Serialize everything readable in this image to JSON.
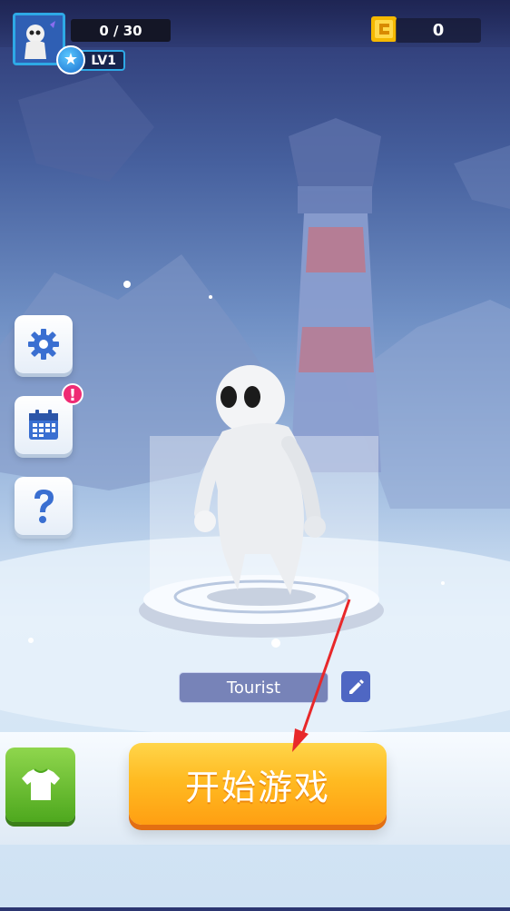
{
  "hud": {
    "xp_text": "0 / 30",
    "level_text": "LV1",
    "coins": "0"
  },
  "character": {
    "name": "Tourist"
  },
  "sidebar": {
    "items": [
      {
        "icon": "gear-icon"
      },
      {
        "icon": "calendar-icon",
        "badge": "!"
      },
      {
        "icon": "help-icon"
      }
    ]
  },
  "bottom": {
    "start_label": "开始游戏",
    "wardrobe_icon": "tshirt-icon"
  },
  "colors": {
    "accent": "#2ea9e6",
    "start": "#ffbb22",
    "wardrobe": "#6cc03a",
    "alert": "#ef2b74"
  }
}
